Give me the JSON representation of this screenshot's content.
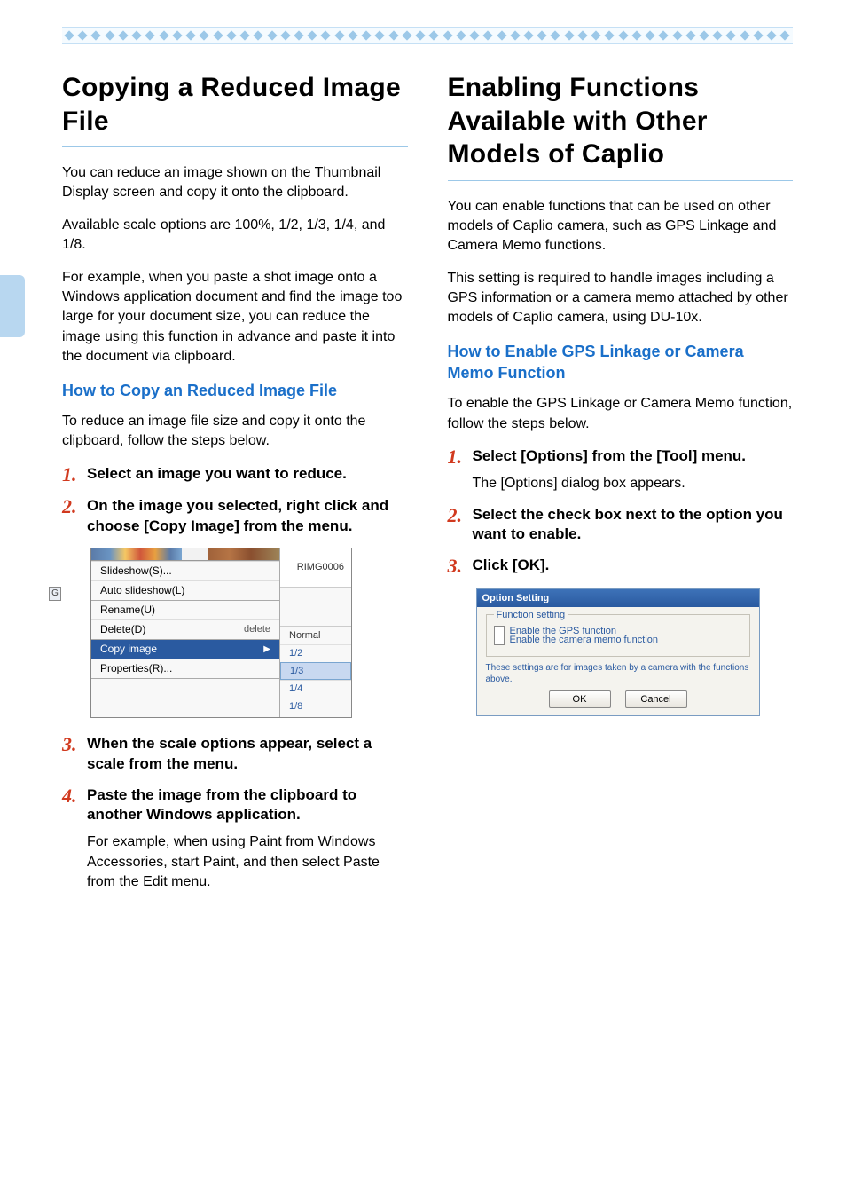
{
  "left": {
    "heading": "Copying a Reduced Image File",
    "p1": "You can reduce an image shown on the Thumbnail Display screen and copy it onto the clipboard.",
    "p2": "Available scale options are 100%, 1/2, 1/3, 1/4, and 1/8.",
    "p3": "For example, when you paste a shot image onto a Windows application document and find the image too large for your document size, you can reduce the image using this function in advance and paste it into the document via clipboard.",
    "sub": "How to Copy an Reduced Image File",
    "p4": "To reduce an image file size and copy it onto the clipboard, follow the steps below.",
    "steps": [
      {
        "title": "Select an image you want to reduce."
      },
      {
        "title": "On the image you selected, right click and choose [Copy Image] from the menu."
      },
      {
        "title": "When the scale options appear, select a scale from the menu."
      },
      {
        "title": "Paste the image from the clipboard to another Windows application.",
        "body": "For example, when using Paint from Windows Accessories, start Paint, and then select Paste from the Edit menu."
      }
    ],
    "menu": {
      "g_tab": "G",
      "slideshow": "Slideshow(S)...",
      "auto_slideshow": "Auto slideshow(L)",
      "rename": "Rename(U)",
      "delete": "Delete(D)",
      "delete_shortcut": "delete",
      "copy_image": "Copy image",
      "properties": "Properties(R)...",
      "right_label": "RIMG0006",
      "submenu": [
        "Normal",
        "1/2",
        "1/3",
        "1/4",
        "1/8"
      ]
    }
  },
  "right": {
    "heading": "Enabling Functions Available with Other Models of Caplio",
    "p1": "You can enable functions that can be used on other models of Caplio camera, such as GPS Linkage and Camera Memo functions.",
    "p2": "This setting is required to handle images including a GPS information or a camera memo attached by other models of Caplio camera, using DU-10x.",
    "sub": "How to Enable GPS Linkage or Camera Memo Function",
    "p3": "To enable the GPS Linkage or Camera Memo function, follow the steps below.",
    "steps": [
      {
        "title": "Select [Options] from the  [Tool] menu.",
        "body": "The [Options] dialog box appears."
      },
      {
        "title": "Select the check box next to the option you want to enable."
      },
      {
        "title": "Click [OK]."
      }
    ],
    "dialog": {
      "title": "Option Setting",
      "legend": "Function setting",
      "opt1": "Enable the GPS function",
      "opt2": "Enable the camera memo function",
      "note": "These settings are for images taken by a camera with the functions above.",
      "ok": "OK",
      "cancel": "Cancel"
    }
  }
}
